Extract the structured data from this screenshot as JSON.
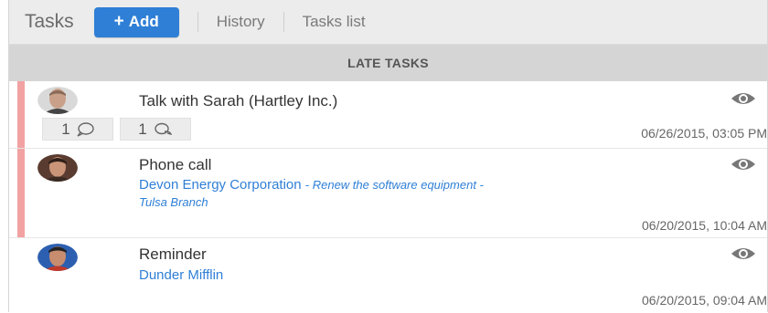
{
  "header": {
    "title": "Tasks",
    "add_label": "Add",
    "links": [
      "History",
      "Tasks list"
    ]
  },
  "section_title": "LATE TASKS",
  "tasks": [
    {
      "name": "Talk with Sarah (Hartley Inc.)",
      "company": "",
      "note": "",
      "note2": "",
      "date": "06/26/2015, 03:05 PM",
      "late": true,
      "comments": "1",
      "replies": "1"
    },
    {
      "name": "Phone call",
      "company": "Devon Energy Corporation",
      "note": "- Renew the software equipment -",
      "note2": "Tulsa Branch",
      "date": "06/20/2015, 10:04 AM",
      "late": true
    },
    {
      "name": "Reminder",
      "company": "Dunder Mifflin",
      "note": "",
      "note2": "",
      "date": "06/20/2015, 09:04 AM",
      "late": false
    }
  ],
  "colors": {
    "accent": "#2f7fd6",
    "late_bar": "#f2a2a2",
    "header_bg": "#ececec",
    "section_bg": "#d5d5d5"
  },
  "icons": [
    "plus-icon",
    "eye-icon",
    "comment-icon",
    "reply-icon"
  ]
}
